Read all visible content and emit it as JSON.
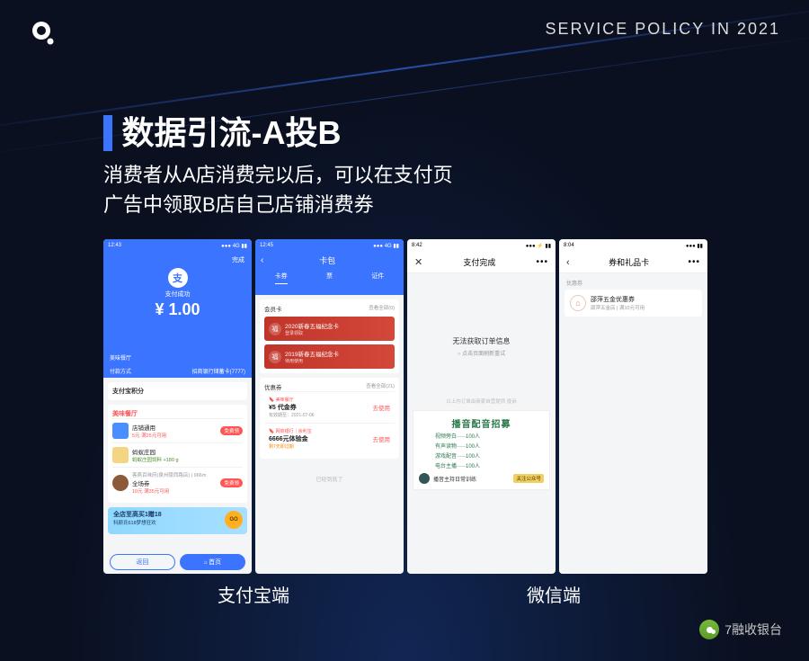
{
  "header": {
    "right": "SERVICE POLICY IN 2021"
  },
  "title": "数据引流-A投B",
  "subtitle_line1": "消费者从A店消费完以后，可以在支付页",
  "subtitle_line2": "广告中领取B店自己店铺消费券",
  "phone1": {
    "time": "12:43",
    "done": "完成",
    "icon": "支",
    "status_label": "支付成功",
    "amount": "¥ 1.00",
    "merchant": "美味餐厅",
    "paymethod_label": "付款方式",
    "paymethod_value": "招商银行储蓄卡(7777)",
    "points_title": "支付宝积分",
    "s2_title": "美味餐厅",
    "r1_title": "店铺通用",
    "r1_sub": "5元 满25元可用",
    "r1_badge": "免费领",
    "r2_title": "蚂蚁庄园",
    "r2_sub": "蚂蚁庄园饲料 +180 g",
    "r3_title": "客燕百味府(泉州陵西路店) | 966m",
    "r3_sub": "全场券",
    "r3_sub2": "10元 满35元可用",
    "r3_badge": "免费领",
    "banner_t1": "全店至高买1赠18",
    "banner_t2": "科颜氏618梦想狂欢",
    "banner_go": "GO",
    "btn_back": "返回",
    "btn_home": "首页"
  },
  "phone2": {
    "time": "12:45",
    "title": "卡包",
    "tabs": [
      "卡券",
      "票",
      "证件"
    ],
    "s1_title": "会员卡",
    "s1_right": "查看全部(0)",
    "card1_t1": "2020新春五福纪念卡",
    "card1_t2": "登录领取",
    "card2_t1": "2019新春五福纪念卡",
    "card2_t2": "待用使用",
    "s2_title": "优惠券",
    "s2_right": "查看全部(21)",
    "c1_tag": "美味餐厅",
    "c1_t1": "¥5 代金券",
    "c1_t2": "有效期至：2021-07-06",
    "c1_use": "去使用",
    "c2_tag": "网商银行｜余利宝",
    "c2_t1": "6666元体验金",
    "c2_t2": "剩7天即过期",
    "c2_use": "去使用",
    "end": "已经到底了"
  },
  "phone3": {
    "time": "8:42",
    "title": "支付完成",
    "msg1": "无法获取订单信息",
    "msg2": "○ 点击页面刷新重试",
    "note": "以上内订单由商家自营提供 投诉",
    "ad_title": "播音配音招募",
    "ad_rows": [
      {
        "label": "视频旁白",
        "count": "100人"
      },
      {
        "label": "有声读物",
        "count": "100人"
      },
      {
        "label": "游戏配音",
        "count": "100人"
      },
      {
        "label": "电台主播",
        "count": "100人"
      }
    ],
    "ad_foot_txt": "播音主持日常训练",
    "ad_foot_btn": "关注公众号"
  },
  "phone4": {
    "time": "8:04",
    "title": "券和礼品卡",
    "section": "优惠券",
    "card_t1": "邵萍五金优惠券",
    "card_t2": "邵萍五金店 | 满10元可用"
  },
  "labels": {
    "alipay": "支付宝端",
    "wechat": "微信端"
  },
  "badge": "7融收银台"
}
